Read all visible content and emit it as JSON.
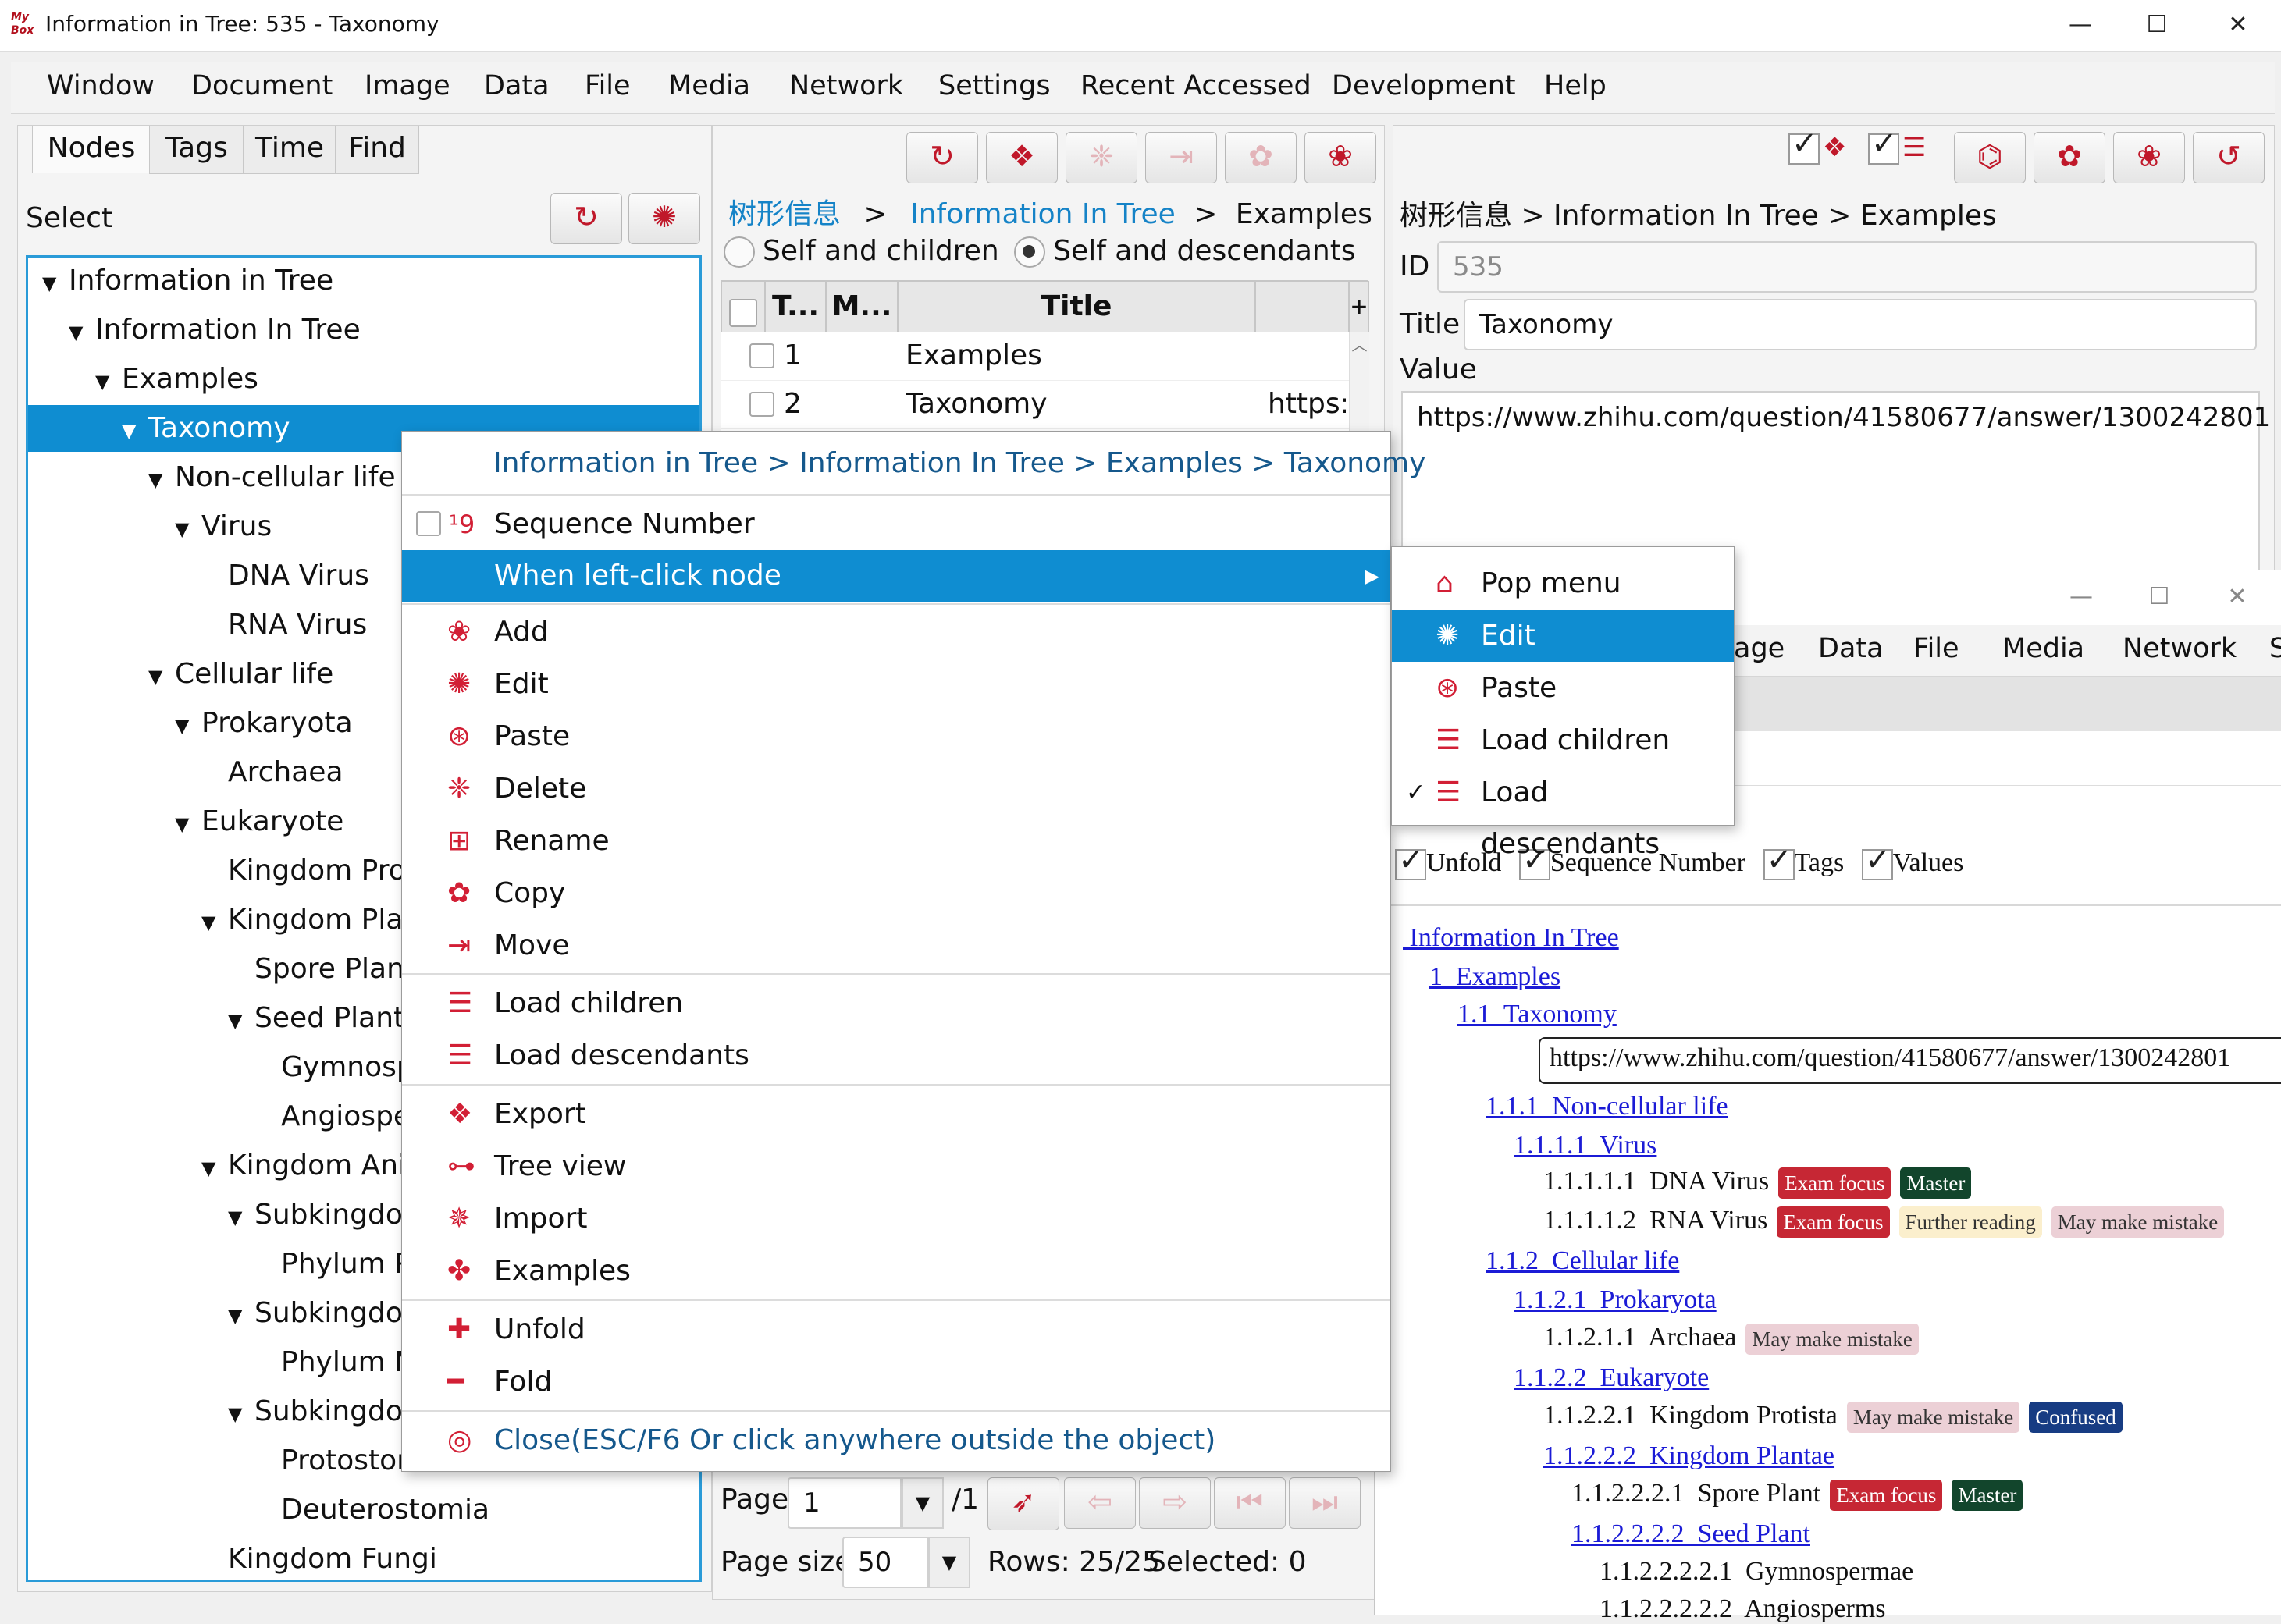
{
  "window": {
    "title": "Information in Tree: 535 - Taxonomy",
    "app_icon_text": "My Box",
    "controls": [
      "minimize-icon",
      "maximize-icon",
      "close-icon"
    ]
  },
  "menubar": [
    "Window",
    "Document",
    "Image",
    "Data",
    "File",
    "Media",
    "Network",
    "Settings",
    "Recent Accessed",
    "Development",
    "Help"
  ],
  "left": {
    "tabs": [
      "Nodes",
      "Tags",
      "Time",
      "Find"
    ],
    "select_label": "Select",
    "tree": [
      {
        "label": "Information in Tree",
        "expanded": true
      },
      {
        "label": "Information In Tree",
        "expanded": true
      },
      {
        "label": "Examples",
        "expanded": true
      },
      {
        "label": "Taxonomy",
        "expanded": true,
        "selected": true
      },
      {
        "label": "Non-cellular life",
        "expanded": true
      },
      {
        "label": "Virus",
        "expanded": true
      },
      {
        "label": "DNA Virus"
      },
      {
        "label": "RNA Virus"
      },
      {
        "label": "Cellular life",
        "expanded": true
      },
      {
        "label": "Prokaryota",
        "expanded": true
      },
      {
        "label": "Archaea"
      },
      {
        "label": "Eukaryote",
        "expanded": true
      },
      {
        "label": "Kingdom Prot"
      },
      {
        "label": "Kingdom Plar",
        "expanded": true
      },
      {
        "label": "Spore Plant"
      },
      {
        "label": "Seed Plant",
        "expanded": true
      },
      {
        "label": "Gymnosp"
      },
      {
        "label": "Angiospe"
      },
      {
        "label": "Kingdom Ani",
        "expanded": true
      },
      {
        "label": "Subkingdor",
        "expanded": true
      },
      {
        "label": "Phylum P"
      },
      {
        "label": "Subkingdor",
        "expanded": true
      },
      {
        "label": "Phylum M"
      },
      {
        "label": "Subkingdor",
        "expanded": true
      },
      {
        "label": "Protostor"
      },
      {
        "label": "Deuterostomia"
      },
      {
        "label": "Kingdom Fungi"
      }
    ]
  },
  "middle": {
    "breadcrumb": {
      "root": "树形信息",
      "link": "Information In Tree",
      "current": "Examples",
      "sep": ">"
    },
    "radios": [
      {
        "label": "Self and children",
        "checked": false
      },
      {
        "label": "Self and descendants",
        "checked": true
      }
    ],
    "columns": [
      "T...",
      "M...",
      "Title",
      "+"
    ],
    "rows": [
      {
        "no": "1",
        "title": "Examples",
        "value": ""
      },
      {
        "no": "2",
        "title": "Taxonomy",
        "value": "https:/"
      }
    ],
    "page_label": "Page",
    "page_value": "1",
    "page_total": "/1",
    "page_size_label": "Page size",
    "page_size_value": "50",
    "rows_status": "Rows: 25/25",
    "selected_status": "Selected: 0"
  },
  "right": {
    "breadcrumb": "树形信息 > Information In Tree > Examples",
    "id_label": "ID",
    "id_value": "535",
    "title_label": "Title",
    "title_value": "Taxonomy",
    "value_label": "Value",
    "value_text": "https://www.zhihu.com/question/41580677/answer/1300242801"
  },
  "context_menu": {
    "header": "Information in Tree > Information In Tree > Examples > Taxonomy",
    "items": [
      {
        "label": "Sequence Number",
        "icon": "sequence-number-icon"
      },
      {
        "label": "When left-click node",
        "icon": "",
        "submenu": true
      },
      {
        "label": "Add",
        "icon": "add-icon"
      },
      {
        "label": "Edit",
        "icon": "edit-icon"
      },
      {
        "label": "Paste",
        "icon": "paste-icon"
      },
      {
        "label": "Delete",
        "icon": "delete-icon"
      },
      {
        "label": "Rename",
        "icon": "rename-icon"
      },
      {
        "label": "Copy",
        "icon": "copy-icon"
      },
      {
        "label": "Move",
        "icon": "move-icon"
      },
      {
        "label": "Load children",
        "icon": "load-children-icon"
      },
      {
        "label": "Load descendants",
        "icon": "load-descendants-icon"
      },
      {
        "label": "Export",
        "icon": "export-icon"
      },
      {
        "label": "Tree view",
        "icon": "tree-view-icon"
      },
      {
        "label": "Import",
        "icon": "import-icon"
      },
      {
        "label": "Examples",
        "icon": "examples-icon"
      },
      {
        "label": "Unfold",
        "icon": "unfold-icon"
      },
      {
        "label": "Fold",
        "icon": "fold-icon"
      },
      {
        "label": "Close(ESC/F6 Or click anywhere outside the object)",
        "icon": "close-menu-icon"
      }
    ]
  },
  "submenu": {
    "items": [
      {
        "label": "Pop menu",
        "icon": "pop-menu-icon",
        "checked": false
      },
      {
        "label": "Edit",
        "icon": "edit-icon",
        "highlighted": true,
        "checked": false
      },
      {
        "label": "Paste",
        "icon": "paste-icon",
        "checked": false
      },
      {
        "label": "Load children",
        "icon": "load-children-icon",
        "checked": false
      },
      {
        "label": "Load descendants",
        "icon": "load-descendants-icon",
        "checked": true
      }
    ]
  },
  "second_window": {
    "menubar": [
      "age",
      "Data",
      "File",
      "Media",
      "Network",
      "S"
    ],
    "options": [
      {
        "label": "Unfold",
        "checked": true
      },
      {
        "label": "Sequence Number",
        "checked": true
      },
      {
        "label": "Tags",
        "checked": true
      },
      {
        "label": "Values",
        "checked": true
      }
    ],
    "tree": [
      {
        "text": " Information In Tree",
        "link": true
      },
      {
        "text": "1  Examples",
        "link": true
      },
      {
        "text": "1.1  Taxonomy",
        "link": true
      },
      {
        "value": "https://www.zhihu.com/question/41580677/answer/1300242801"
      },
      {
        "text": "1.1.1  Non-cellular life",
        "link": true
      },
      {
        "text": "1.1.1.1  Virus",
        "link": true
      },
      {
        "text": "1.1.1.1.1  DNA Virus",
        "link": false,
        "tags": [
          {
            "label": "Exam focus",
            "kind": "exam"
          },
          {
            "label": "Master",
            "kind": "master"
          }
        ]
      },
      {
        "text": "1.1.1.1.2  RNA Virus",
        "link": false,
        "tags": [
          {
            "label": "Exam focus",
            "kind": "exam"
          },
          {
            "label": "Further reading",
            "kind": "further"
          },
          {
            "label": "May make mistake",
            "kind": "mistake"
          }
        ]
      },
      {
        "text": "1.1.2  Cellular life",
        "link": true
      },
      {
        "text": "1.1.2.1  Prokaryota",
        "link": true
      },
      {
        "text": "1.1.2.1.1  Archaea",
        "link": false,
        "tags": [
          {
            "label": "May make mistake",
            "kind": "mistake"
          }
        ]
      },
      {
        "text": "1.1.2.2  Eukaryote",
        "link": true
      },
      {
        "text": "1.1.2.2.1  Kingdom Protista",
        "link": false,
        "tags": [
          {
            "label": "May make mistake",
            "kind": "mistake"
          },
          {
            "label": "Confused",
            "kind": "confused"
          }
        ]
      },
      {
        "text": "1.1.2.2.2  Kingdom Plantae",
        "link": true
      },
      {
        "text": "1.1.2.2.2.1  Spore Plant",
        "link": false,
        "tags": [
          {
            "label": "Exam focus",
            "kind": "exam"
          },
          {
            "label": "Master",
            "kind": "master"
          }
        ]
      },
      {
        "text": "1.1.2.2.2.2  Seed Plant",
        "link": true
      },
      {
        "text": "1.1.2.2.2.2.1  Gymnospermae",
        "link": false
      },
      {
        "text": "1.1.2.2.2.2.2  Angiosperms",
        "link": false
      }
    ]
  },
  "colors": {
    "accent": "#0f8dd1",
    "icon_red": "#c0182a",
    "link_blue": "#1b1bd6"
  }
}
